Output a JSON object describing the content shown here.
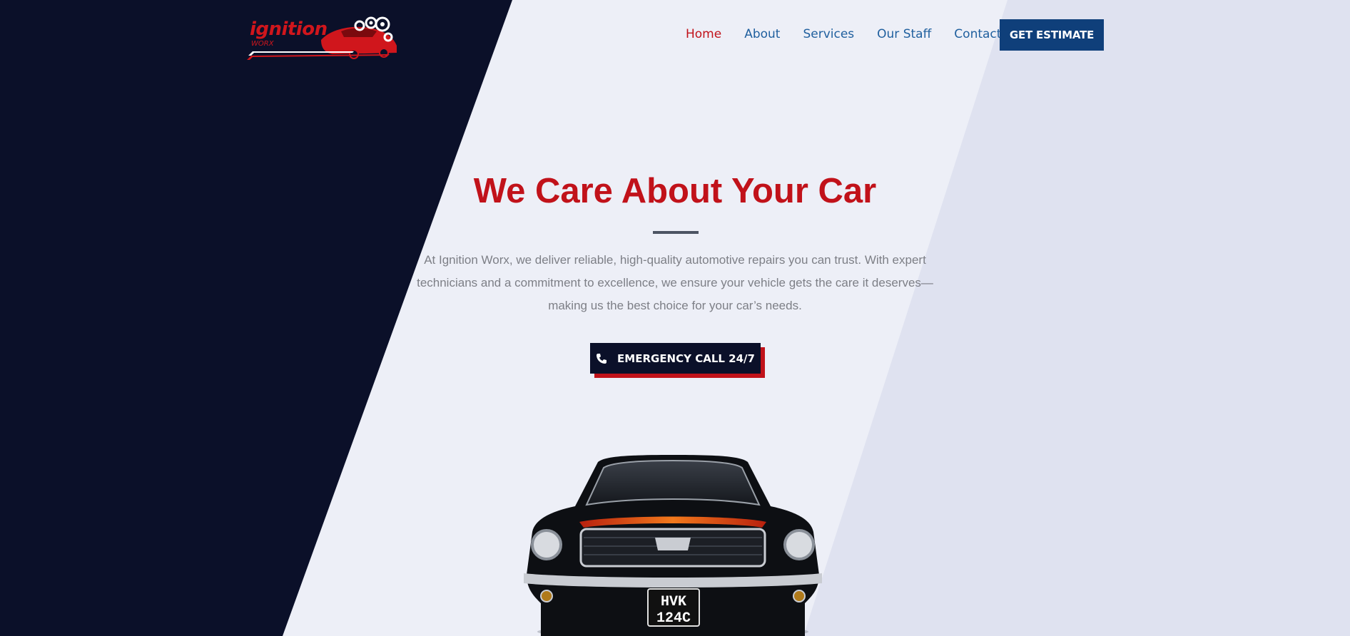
{
  "brand": {
    "name": "ignition",
    "sub": "WORX",
    "colors": {
      "red": "#c1121a",
      "navy": "#0b1029",
      "blue": "#0f3f7a",
      "link": "#1f5f9e"
    }
  },
  "nav": {
    "items": [
      {
        "label": "Home",
        "active": true
      },
      {
        "label": "About",
        "active": false
      },
      {
        "label": "Services",
        "active": false
      },
      {
        "label": "Our Staff",
        "active": false
      },
      {
        "label": "Contact",
        "active": false
      }
    ],
    "cta_label": "GET ESTIMATE"
  },
  "hero": {
    "title": "We Care About Your Car",
    "text": "At Ignition Worx, we deliver reliable, high-quality automotive repairs you can trust. With expert technicians and a commitment to excellence, we ensure your vehicle gets the care it deserves—making us the best choice for your car’s needs.",
    "emergency_label": "EMERGENCY CALL 24/7",
    "emergency_icon": "phone-icon",
    "car_plate": [
      "HVK",
      "124C"
    ]
  }
}
